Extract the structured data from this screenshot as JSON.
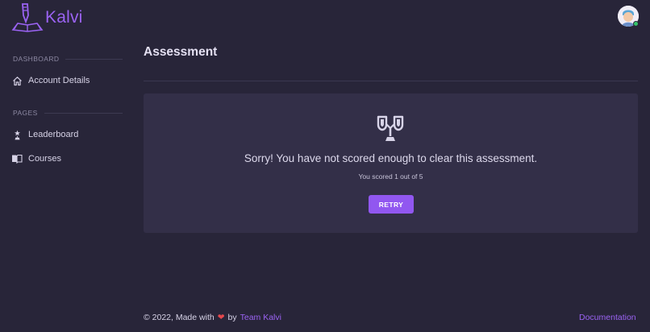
{
  "brand": {
    "name": "Kalvi",
    "accent": "#9b63f3"
  },
  "sidebar": {
    "sections": [
      {
        "header": "DASHBOARD",
        "items": [
          {
            "label": "Account Details",
            "icon": "home-icon"
          }
        ]
      },
      {
        "header": "PAGES",
        "items": [
          {
            "label": "Leaderboard",
            "icon": "star-trophy-icon"
          },
          {
            "label": "Courses",
            "icon": "book-icon"
          }
        ]
      }
    ]
  },
  "main": {
    "title": "Assessment",
    "result": {
      "icon": "trophy-icon",
      "message": "Sorry! You have not scored enough to clear this assessment.",
      "score": "You scored 1 out of 5",
      "retry_label": "RETRY"
    }
  },
  "footer": {
    "copyright": "© 2022, Made with",
    "heart": "❤",
    "by": "by",
    "team": "Team Kalvi",
    "docs": "Documentation"
  },
  "user": {
    "avatar_icon": "avatar-icon",
    "status_color": "#35c46a"
  }
}
